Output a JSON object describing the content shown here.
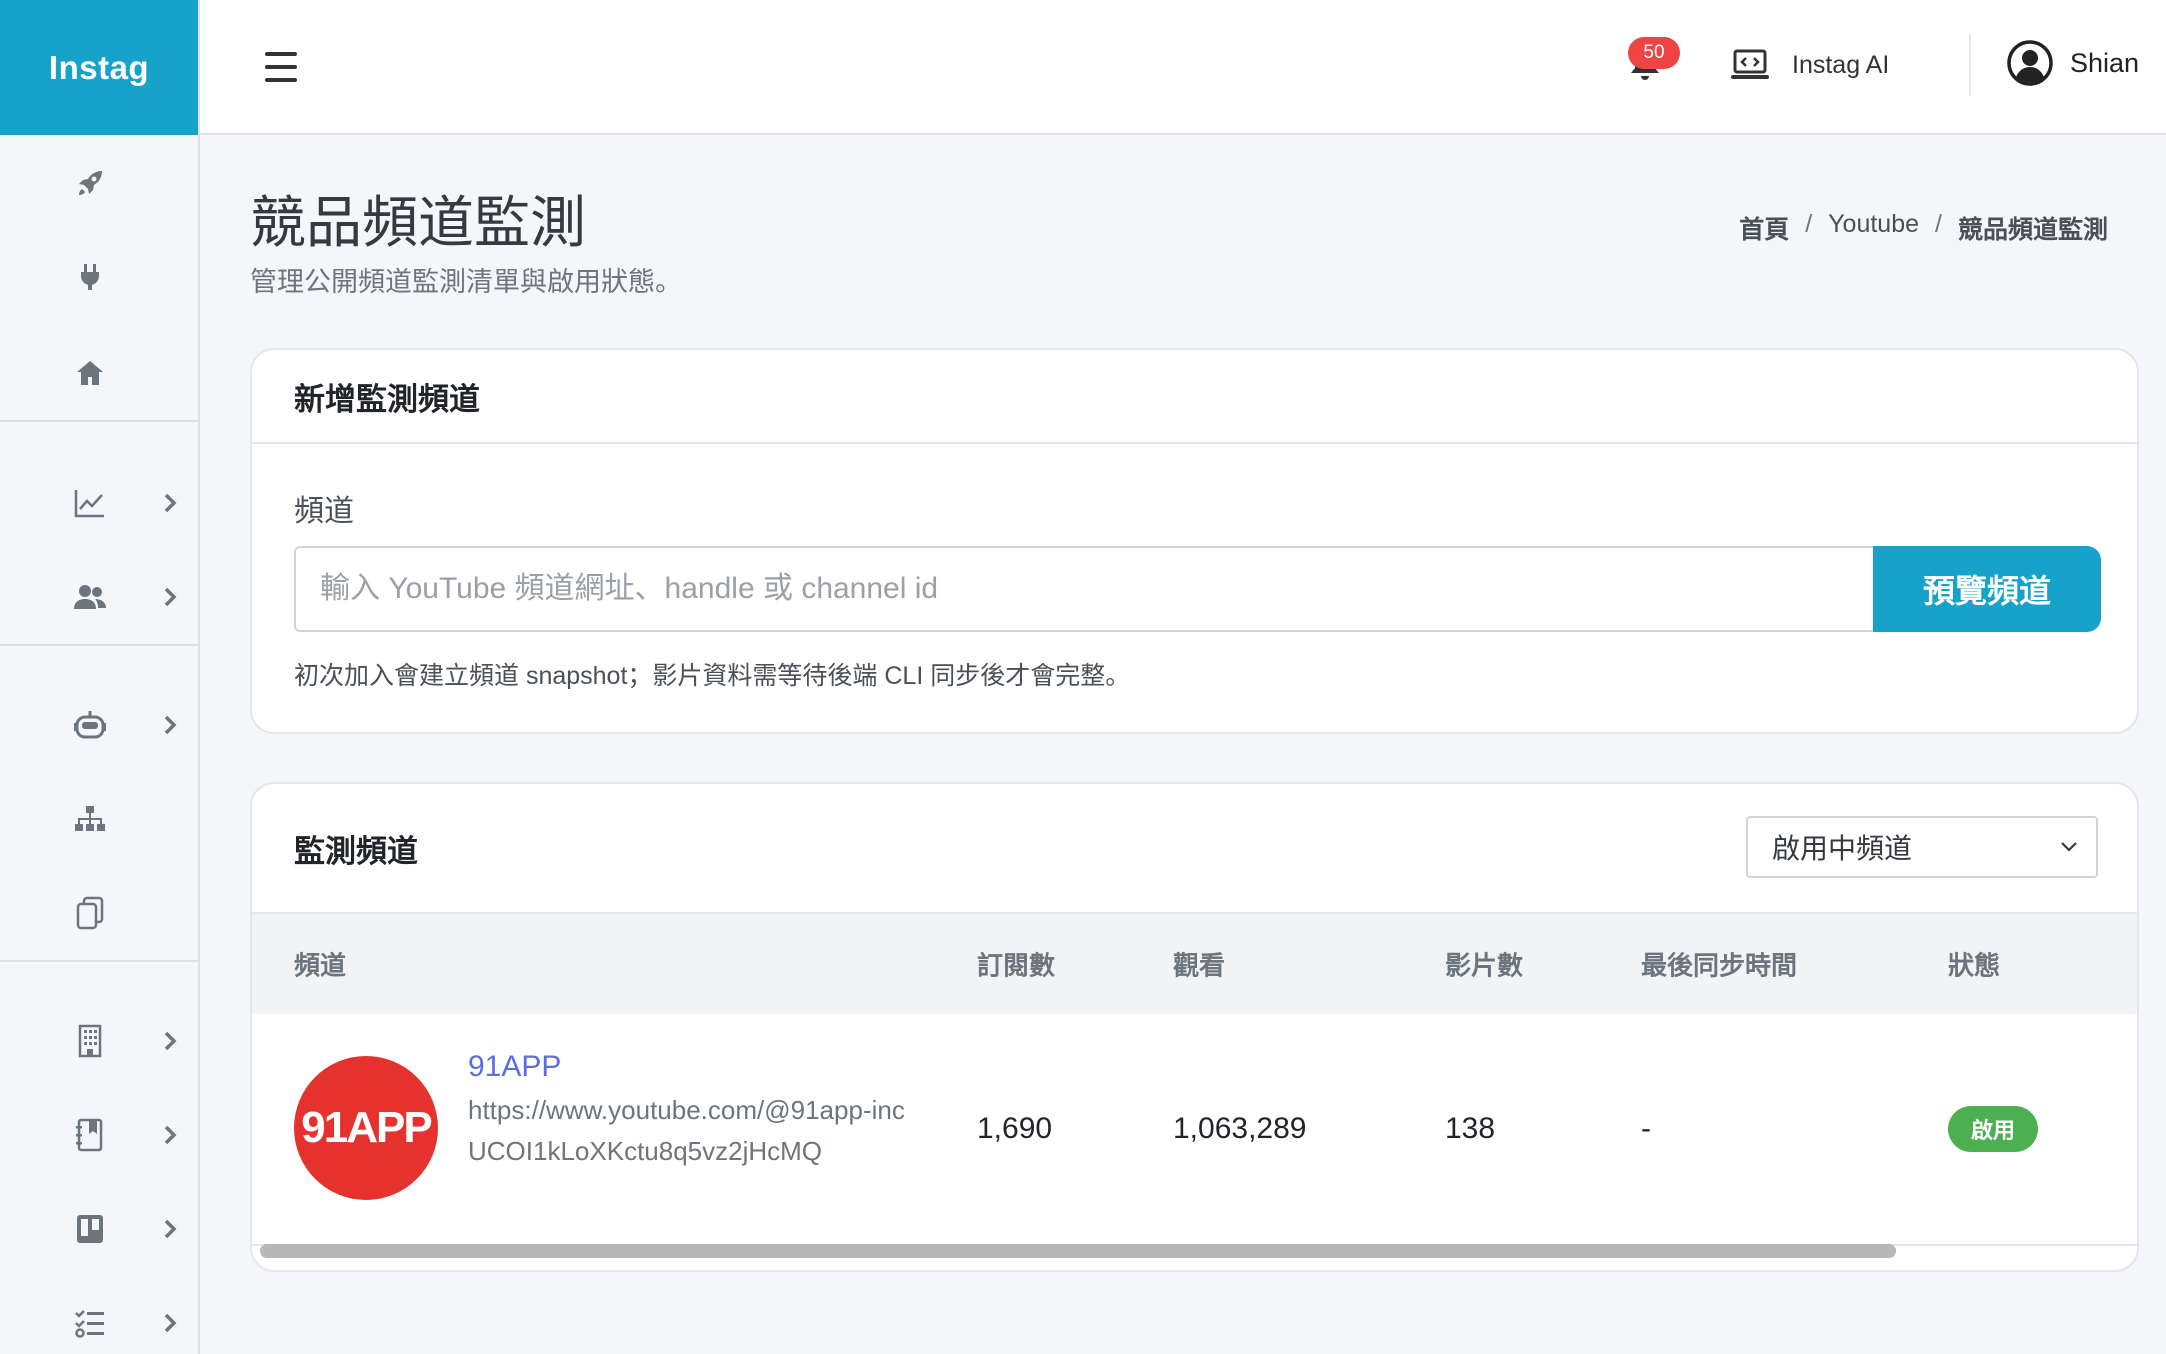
{
  "app": {
    "brand": "Instag"
  },
  "sidebar": {
    "items": [
      {
        "icon": "rocket-icon"
      },
      {
        "icon": "plug-icon"
      },
      {
        "icon": "home-icon"
      },
      {
        "icon": "chart-line-icon",
        "expandable": true
      },
      {
        "icon": "users-icon",
        "expandable": true
      },
      {
        "icon": "robot-icon",
        "expandable": true
      },
      {
        "icon": "sitemap-icon"
      },
      {
        "icon": "copy-icon"
      },
      {
        "icon": "building-icon",
        "expandable": true
      },
      {
        "icon": "book-icon",
        "expandable": true
      },
      {
        "icon": "board-icon",
        "expandable": true
      },
      {
        "icon": "checklist-icon",
        "expandable": true
      }
    ]
  },
  "navbar": {
    "notification_count": "50",
    "ai_label": "Instag AI",
    "user_name": "Shian"
  },
  "page": {
    "title": "競品頻道監測",
    "subtitle": "管理公開頻道監測清單與啟用狀態。",
    "breadcrumb": {
      "home": "首頁",
      "section": "Youtube",
      "current": "競品頻道監測",
      "separator": "/"
    }
  },
  "add_card": {
    "title": "新增監測頻道",
    "field_label": "頻道",
    "input_placeholder": "輸入 YouTube 頻道網址、handle 或 channel id",
    "input_value": "",
    "button_label": "預覽頻道",
    "help_text": "初次加入會建立頻道 snapshot；影片資料需等待後端 CLI 同步後才會完整。"
  },
  "list_card": {
    "title": "監測頻道",
    "filter_value": "啟用中頻道",
    "columns": [
      "頻道",
      "訂閱數",
      "觀看",
      "影片數",
      "最後同步時間",
      "狀態"
    ],
    "rows": [
      {
        "avatar_text": "91APP",
        "name": "91APP",
        "url": "https://www.youtube.com/@91app-inc",
        "channel_id": "UCOI1kLoXKctu8q5vz2jHcMQ",
        "subscribers": "1,690",
        "views": "1,063,289",
        "videos": "138",
        "last_sync": "-",
        "status": "啟用"
      }
    ]
  },
  "colors": {
    "brand": "#17a2c9",
    "badge_red": "#ef4444",
    "status_green": "#4caf50",
    "link": "#5b6ee1"
  }
}
